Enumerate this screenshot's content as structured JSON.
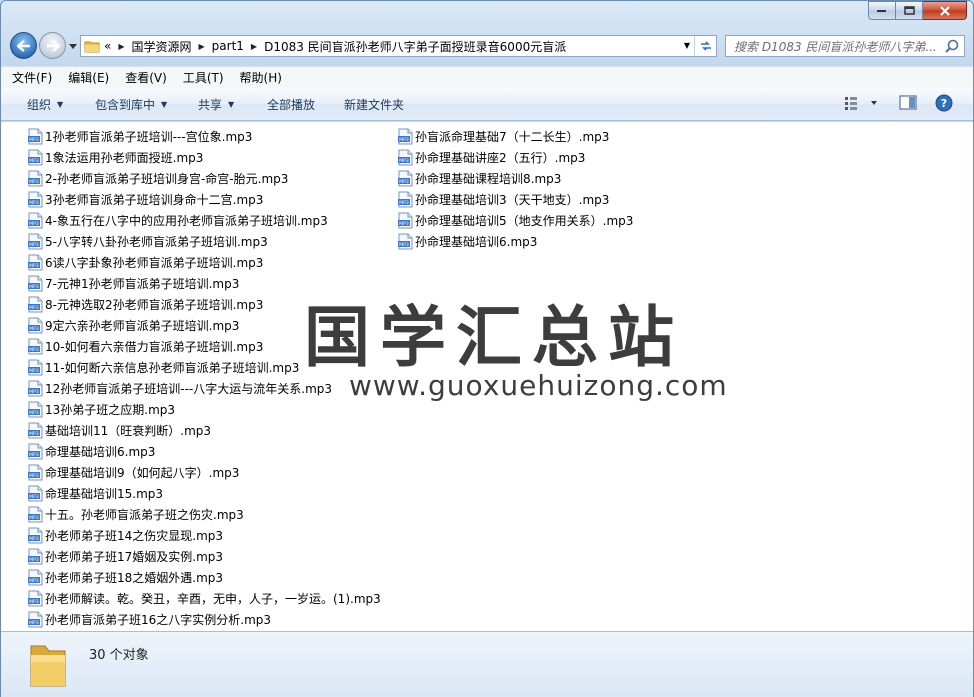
{
  "caption_buttons": {
    "minimize": "minimize",
    "maximize": "maximize",
    "close": "close"
  },
  "address": {
    "overflow_chevron": "«",
    "crumbs": [
      "国学资源网",
      "part1",
      "D1083 民间盲派孙老师八字弟子面授班录音6000元盲派"
    ]
  },
  "search": {
    "placeholder": "搜索 D1083 民间盲派孙老师八字弟..."
  },
  "menu": [
    "文件(F)",
    "编辑(E)",
    "查看(V)",
    "工具(T)",
    "帮助(H)"
  ],
  "toolbar": {
    "organize": "组织",
    "include_library": "包含到库中",
    "share": "共享",
    "play_all": "全部播放",
    "new_folder": "新建文件夹"
  },
  "files_col1": [
    "1孙老师盲派弟子班培训---宫位象.mp3",
    "1象法运用孙老师面授班.mp3",
    "2-孙老师盲派弟子班培训身宫-命宫-胎元.mp3",
    "3孙老师盲派弟子班培训身命十二宫.mp3",
    "4-象五行在八字中的应用孙老师盲派弟子班培训.mp3",
    "5-八字转八卦孙老师盲派弟子班培训.mp3",
    "6读八字卦象孙老师盲派弟子班培训.mp3",
    "7-元神1孙老师盲派弟子班培训.mp3",
    "8-元神选取2孙老师盲派弟子班培训.mp3",
    "9定六亲孙老师盲派弟子班培训.mp3",
    "10-如何看六亲借力盲派弟子班培训.mp3",
    "11-如何断六亲信息孙老师盲派弟子班培训.mp3",
    "12孙老师盲派弟子班培训---八字大运与流年关系.mp3",
    "13孙弟子班之应期.mp3",
    "基础培训11（旺衰判断）.mp3",
    "命理基础培训6.mp3",
    "命理基础培训9（如何起八字）.mp3",
    "命理基础培训15.mp3",
    "十五。孙老师盲派弟子班之伤灾.mp3",
    "孙老师弟子班14之伤灾显现.mp3",
    "孙老师弟子班17婚姻及实例.mp3",
    "孙老师弟子班18之婚姻外遇.mp3",
    "孙老师解读。乾。癸丑，辛酉，无申，人子，一岁运。(1).mp3",
    "孙老师盲派弟子班16之八字实例分析.mp3"
  ],
  "files_col2": [
    "孙盲派命理基础7（十二长生）.mp3",
    "孙命理基础讲座2（五行）.mp3",
    "孙命理基础课程培训8.mp3",
    "孙命理基础培训3（天干地支）.mp3",
    "孙命理基础培训5（地支作用关系）.mp3",
    "孙命理基础培训6.mp3"
  ],
  "watermark": {
    "title": "国学汇总站",
    "url": "www.guoxuehuizong.com"
  },
  "status": {
    "count": "30 个对象"
  },
  "icons": {
    "back": "back-arrow-icon",
    "forward": "forward-arrow-icon",
    "folder": "folder-icon",
    "refresh": "refresh-icon",
    "search": "search-icon",
    "view": "view-options-icon",
    "preview": "preview-pane-icon",
    "help": "help-icon",
    "file": "mp3-file-icon"
  },
  "colors": {
    "accent": "#1e395b",
    "window_bg": "#c9dcef",
    "link": "#1e395b"
  }
}
